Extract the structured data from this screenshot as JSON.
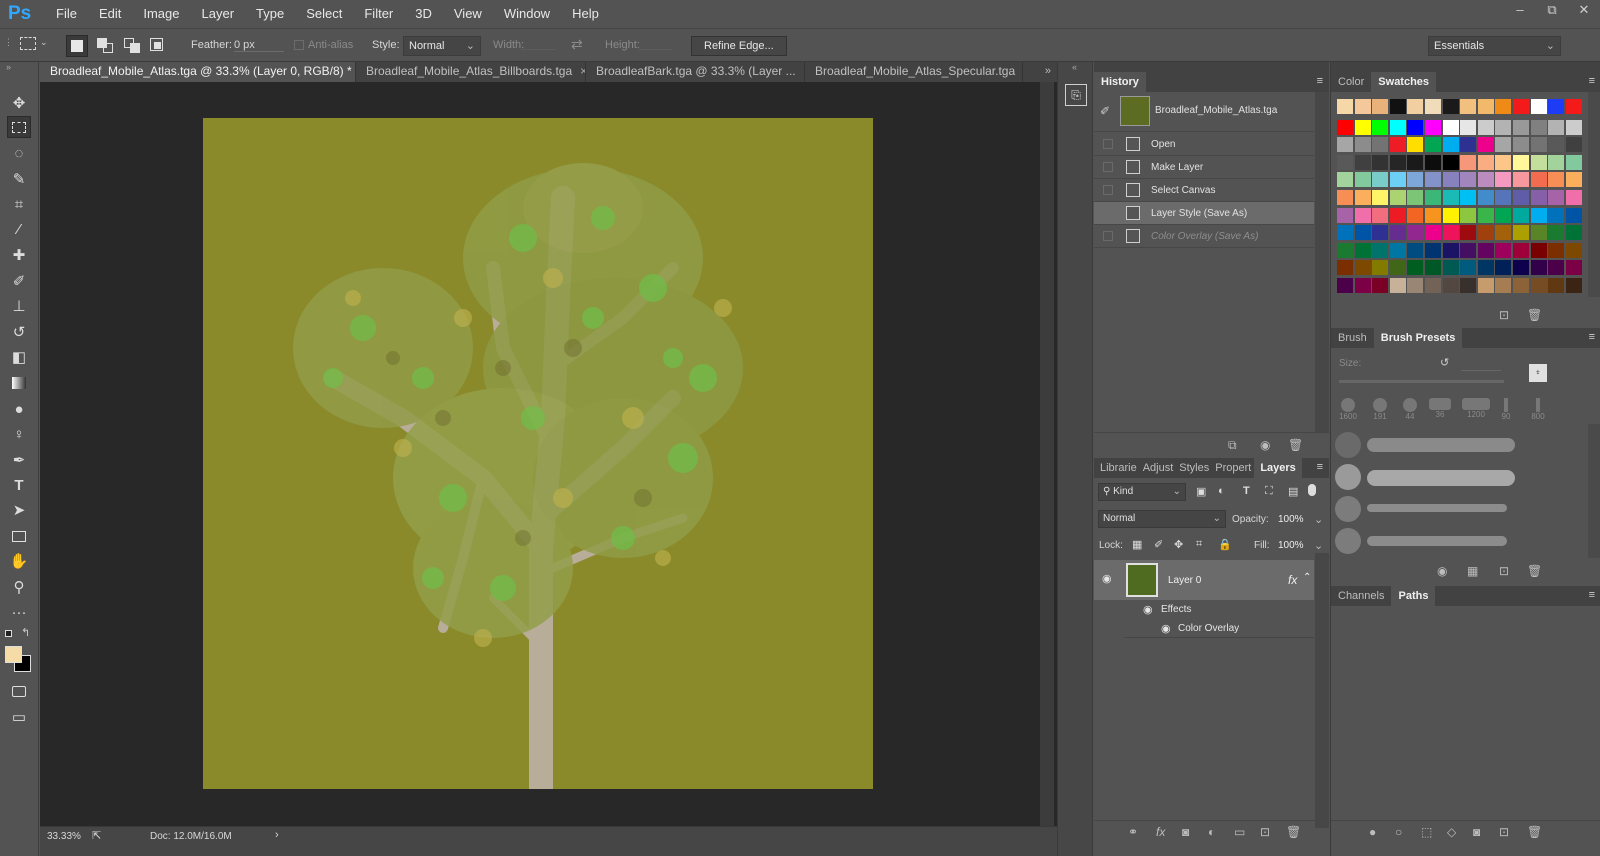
{
  "app": {
    "logo": "Ps"
  },
  "menu": [
    "File",
    "Edit",
    "Image",
    "Layer",
    "Type",
    "Select",
    "Filter",
    "3D",
    "View",
    "Window",
    "Help"
  ],
  "window_controls": [
    "–",
    "⧉",
    "✕"
  ],
  "options": {
    "feather_label": "Feather:",
    "feather_value": "0 px",
    "antialias_label": "Anti-alias",
    "style_label": "Style:",
    "style_value": "Normal",
    "width_label": "Width:",
    "height_label": "Height:",
    "refine_edge": "Refine Edge...",
    "workspace": "Essentials"
  },
  "tabs": [
    {
      "label": "Broadleaf_Mobile_Atlas.tga @ 33.3% (Layer 0, RGB/8) *",
      "close": "×",
      "active": true
    },
    {
      "label": "Broadleaf_Mobile_Atlas_Billboards.tga",
      "close": "×",
      "active": false
    },
    {
      "label": "BroadleafBark.tga @ 33.3% (Layer ...",
      "close": "×",
      "active": false
    },
    {
      "label": "Broadleaf_Mobile_Atlas_Specular.tga",
      "close": "×",
      "active": false
    }
  ],
  "status": {
    "zoom": "33.33%",
    "doc": "Doc: 12.0M/16.0M",
    "arrow": "›"
  },
  "colors": {
    "canvas": "#8a8a2b",
    "foreground": "#f5dba8",
    "background": "#000000"
  },
  "history": {
    "tab": "History",
    "snapshot": "Broadleaf_Mobile_Atlas.tga",
    "items": [
      "Open",
      "Make Layer",
      "Select Canvas",
      "Layer Style (Save As)",
      "Color Overlay (Save As)"
    ]
  },
  "swatch_panel": {
    "tabs": [
      "Color",
      "Swatches"
    ],
    "rows": [
      [
        "#f6d7a8",
        "#f4c89a",
        "#e8b27a",
        "#111111",
        "#f2cfa0",
        "#f0dcb8",
        "#1a1a1a",
        "#f2c07e",
        "#f3b96a",
        "#ef8a16",
        "#f21a1a",
        "#ffffff",
        "#1e3cf5",
        "#f51a1a"
      ],
      [
        "#ff0000",
        "#ffff00",
        "#00ff00",
        "#00ffff",
        "#0000ff",
        "#ff00ff",
        "#ffffff",
        "#e6e6e6",
        "#cccccc",
        "#b3b3b3",
        "#999999",
        "#808080",
        "#b3b3b3",
        "#cccccc"
      ],
      [
        "#a6a6a6",
        "#8c8c8c",
        "#737373",
        "#ee1c24",
        "#ffde00",
        "#00a651",
        "#00aeef",
        "#2e3192",
        "#ec008c",
        "#a6a6a6",
        "#8c8c8c",
        "#737373",
        "#595959",
        "#404040"
      ],
      [
        "#595959",
        "#404040",
        "#333333",
        "#262626",
        "#1a1a1a",
        "#0d0d0d",
        "#000000",
        "#f7977a",
        "#fbad82",
        "#fdc689",
        "#fff79a",
        "#c4df9b",
        "#a3d39c",
        "#82ca9d"
      ],
      [
        "#a3d39c",
        "#82ca9d",
        "#7accc8",
        "#6dcff6",
        "#7da7d9",
        "#8393ca",
        "#8781bd",
        "#a186be",
        "#bd8cbf",
        "#f49ac1",
        "#f6989d",
        "#f26c4f",
        "#f68e55",
        "#fbaf5c"
      ],
      [
        "#f68e55",
        "#fbaf5c",
        "#fff467",
        "#acd372",
        "#7cc576",
        "#3bb878",
        "#1abbb4",
        "#00bff3",
        "#438ccb",
        "#5574b9",
        "#605ca8",
        "#855fa8",
        "#a763a8",
        "#f06ea9"
      ],
      [
        "#a763a8",
        "#f06ea9",
        "#f26d7d",
        "#ed1c24",
        "#f26522",
        "#f7941d",
        "#fff200",
        "#8dc63f",
        "#39b54a",
        "#00a651",
        "#00a99d",
        "#00aeef",
        "#0072bc",
        "#0054a6"
      ],
      [
        "#0072bc",
        "#0054a6",
        "#2e3192",
        "#662d91",
        "#92278f",
        "#ec008c",
        "#ed145b",
        "#9e0b0f",
        "#a0410d",
        "#a36209",
        "#aba000",
        "#598527",
        "#1a7b30",
        "#007236"
      ],
      [
        "#1a7b30",
        "#007236",
        "#00746b",
        "#0076a3",
        "#004b80",
        "#003471",
        "#1b1464",
        "#440e62",
        "#630460",
        "#9e005d",
        "#9e0039",
        "#790000",
        "#7b2e00",
        "#7d4900"
      ],
      [
        "#7b2e00",
        "#7d4900",
        "#827b00",
        "#406618",
        "#005e20",
        "#005826",
        "#005952",
        "#005b7f",
        "#003663",
        "#002157",
        "#0d004c",
        "#32004b",
        "#4b0049",
        "#7b0046"
      ],
      [
        "#4b0049",
        "#7b0046",
        "#7a0026",
        "#c7b299",
        "#998675",
        "#736357",
        "#534741",
        "#37302d",
        "#c69c6d",
        "#a67c52",
        "#8c6239",
        "#754c24",
        "#603913",
        "#3c2415"
      ]
    ]
  },
  "brush": {
    "tabs": [
      "Brush",
      "Brush Presets"
    ],
    "size_label": "Size:",
    "presets": [
      "1600",
      "191",
      "44",
      "36",
      "1200",
      "90",
      "800"
    ]
  },
  "layers_panel": {
    "tabs": [
      "Librarie",
      "Adjust",
      "Styles",
      "Propert",
      "Layers"
    ],
    "kind": "Kind",
    "blend": "Normal",
    "opacity_label": "Opacity:",
    "opacity": "100%",
    "lock_label": "Lock:",
    "fill_label": "Fill:",
    "fill": "100%",
    "layer_name": "Layer 0",
    "fx": "fx",
    "effects": "Effects",
    "effect": "Color Overlay"
  },
  "paths_panel": {
    "tabs": [
      "Channels",
      "Paths"
    ]
  }
}
